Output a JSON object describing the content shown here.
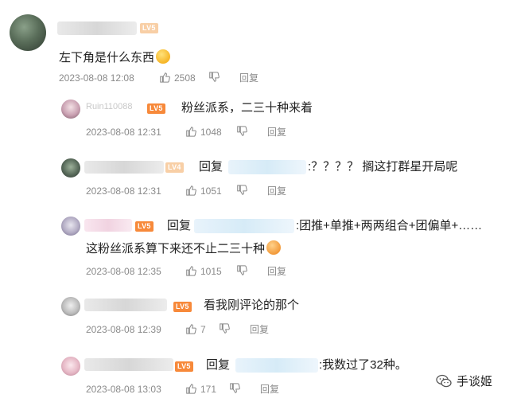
{
  "comments": [
    {
      "text": "左下角是什么东西",
      "time": "2023-08-08 12:08",
      "likes": "2508",
      "reply_label": "回复",
      "badge": "LV5",
      "emoji": "sleepy-face"
    },
    {
      "name_partial": "Ruin110088",
      "text": "粉丝派系，二三十种来着",
      "time": "2023-08-08 12:31",
      "likes": "1048",
      "reply_label": "回复",
      "badge": "LV5"
    },
    {
      "prefix": "回复",
      "text": ":？？？？ 搁这打群星开局呢",
      "time": "2023-08-08 12:31",
      "likes": "1051",
      "reply_label": "回复",
      "badge": "LV4"
    },
    {
      "prefix": "回复",
      "text_line1": ":团推+单推+两两组合+团偏单+……",
      "text_line2": "这粉丝派系算下来还不止二三十种",
      "time": "2023-08-08 12:35",
      "likes": "1015",
      "reply_label": "回复",
      "badge": "LV5",
      "emoji": "drooling-face"
    },
    {
      "text": "看我刚评论的那个",
      "time": "2023-08-08 12:39",
      "likes": "7",
      "reply_label": "回复",
      "badge": "LV5"
    },
    {
      "prefix": "回复",
      "text": ":我数过了32种。",
      "time": "2023-08-08 13:03",
      "likes": "171",
      "reply_label": "回复",
      "badge": "LV5"
    }
  ],
  "watermark": {
    "text": "手谈姬",
    "icon": "wechat-icon"
  },
  "colors": {
    "badge": "#f7893a",
    "meta": "#8a8a8a",
    "text": "#222222"
  }
}
